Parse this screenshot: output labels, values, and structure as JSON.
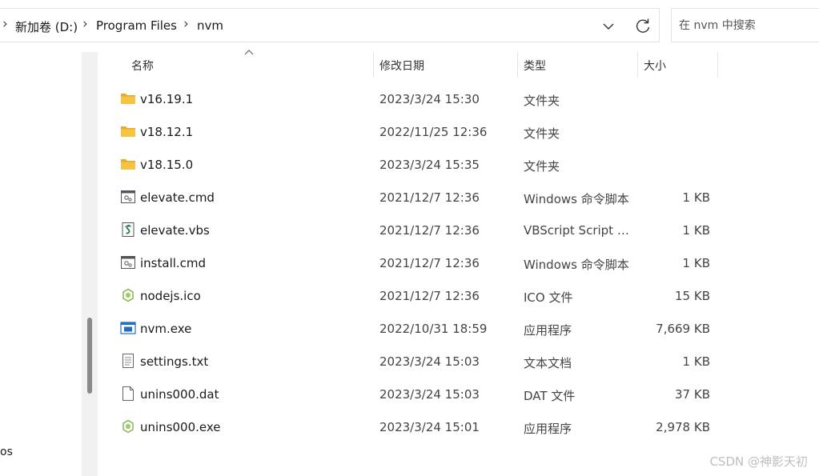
{
  "address": {
    "breadcrumbs": [
      "新加卷 (D:)",
      "Program Files",
      "nvm"
    ],
    "separator": "›"
  },
  "search": {
    "placeholder": "在 nvm 中搜索"
  },
  "nav": {
    "partial_item": "os"
  },
  "columns": {
    "name": "名称",
    "date": "修改日期",
    "type": "类型",
    "size": "大小"
  },
  "files": [
    {
      "name": "v16.19.1",
      "date": "2023/3/24 15:30",
      "type": "文件夹",
      "size": "",
      "icon": "folder-icon"
    },
    {
      "name": "v18.12.1",
      "date": "2022/11/25 12:36",
      "type": "文件夹",
      "size": "",
      "icon": "folder-icon"
    },
    {
      "name": "v18.15.0",
      "date": "2023/3/24 15:35",
      "type": "文件夹",
      "size": "",
      "icon": "folder-icon"
    },
    {
      "name": "elevate.cmd",
      "date": "2021/12/7 12:36",
      "type": "Windows 命令脚本",
      "size": "1 KB",
      "icon": "cmd-script-icon"
    },
    {
      "name": "elevate.vbs",
      "date": "2021/12/7 12:36",
      "type": "VBScript Script …",
      "size": "1 KB",
      "icon": "vbscript-icon"
    },
    {
      "name": "install.cmd",
      "date": "2021/12/7 12:36",
      "type": "Windows 命令脚本",
      "size": "1 KB",
      "icon": "cmd-script-icon"
    },
    {
      "name": "nodejs.ico",
      "date": "2021/12/7 12:36",
      "type": "ICO 文件",
      "size": "15 KB",
      "icon": "nodejs-icon"
    },
    {
      "name": "nvm.exe",
      "date": "2022/10/31 18:59",
      "type": "应用程序",
      "size": "7,669 KB",
      "icon": "exe-window-icon"
    },
    {
      "name": "settings.txt",
      "date": "2023/3/24 15:03",
      "type": "文本文档",
      "size": "1 KB",
      "icon": "text-file-icon"
    },
    {
      "name": "unins000.dat",
      "date": "2023/3/24 15:03",
      "type": "DAT 文件",
      "size": "37 KB",
      "icon": "blank-file-icon"
    },
    {
      "name": "unins000.exe",
      "date": "2023/3/24 15:01",
      "type": "应用程序",
      "size": "2,978 KB",
      "icon": "nodejs-icon"
    }
  ],
  "watermark": "CSDN @神影天初",
  "colors": {
    "folder": "#f6c343",
    "node_green": "#7cb342",
    "exe_blue": "#1e6fc4"
  }
}
